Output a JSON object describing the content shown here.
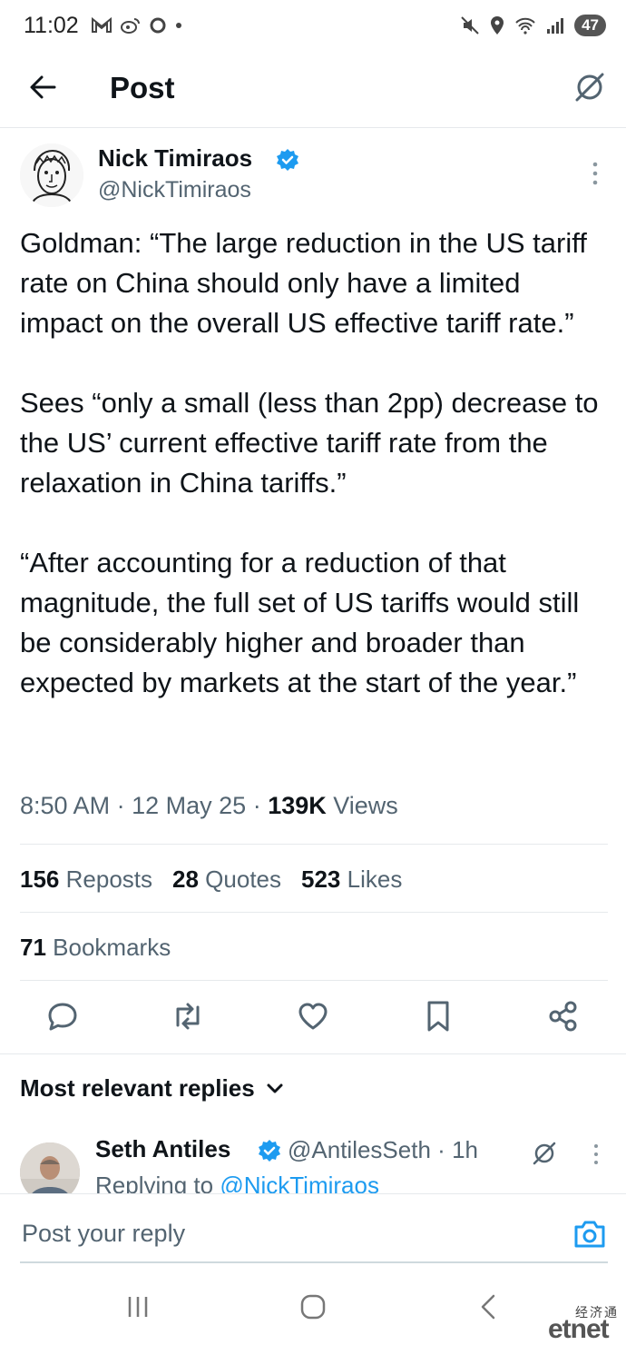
{
  "status_bar": {
    "time": "11:02",
    "battery": "47",
    "left_icons": [
      "gmail-icon",
      "weibo-icon",
      "circle-app-icon",
      "dot-icon"
    ],
    "right_icons": [
      "mute-icon",
      "location-icon",
      "wifi-icon",
      "signal-icon"
    ]
  },
  "header": {
    "title": "Post"
  },
  "post": {
    "author_name": "Nick Timiraos",
    "author_handle": "@NickTimiraos",
    "paragraphs": [
      "Goldman: “The large reduction in the US tariff rate on China should only have a limited impact on the overall US effective tariff rate.”",
      "Sees “only a small (less than 2pp) decrease to the US’ current effective tariff rate from the relaxation in China tariffs.”",
      "“After accounting for a reduction of that magnitude, the full set of US tariffs would still be considerably higher and broader than expected by markets at the start of the year.”"
    ],
    "time": "8:50 AM",
    "date": "12 May 25",
    "views_count": "139K",
    "views_label": "Views",
    "separator": "·"
  },
  "stats": {
    "reposts_count": "156",
    "reposts_label": "Reposts",
    "quotes_count": "28",
    "quotes_label": "Quotes",
    "likes_count": "523",
    "likes_label": "Likes",
    "bookmarks_count": "71",
    "bookmarks_label": "Bookmarks"
  },
  "actions": [
    "reply-icon",
    "repost-icon",
    "like-icon",
    "bookmark-icon",
    "share-icon"
  ],
  "replies": {
    "header": "Most relevant replies",
    "first": {
      "name": "Seth Antiles",
      "handle": "@AntilesSeth",
      "time": "1h",
      "replying_prefix": "Replying to",
      "replying_handle": "@NickTimiraos"
    }
  },
  "composer": {
    "placeholder": "Post your reply"
  },
  "watermark": {
    "chinese": "经济通",
    "english": "etnet"
  },
  "colors": {
    "accent": "#1d9bf0",
    "text": "#0f1419",
    "muted": "#536471",
    "divider": "#e6e9ec"
  }
}
